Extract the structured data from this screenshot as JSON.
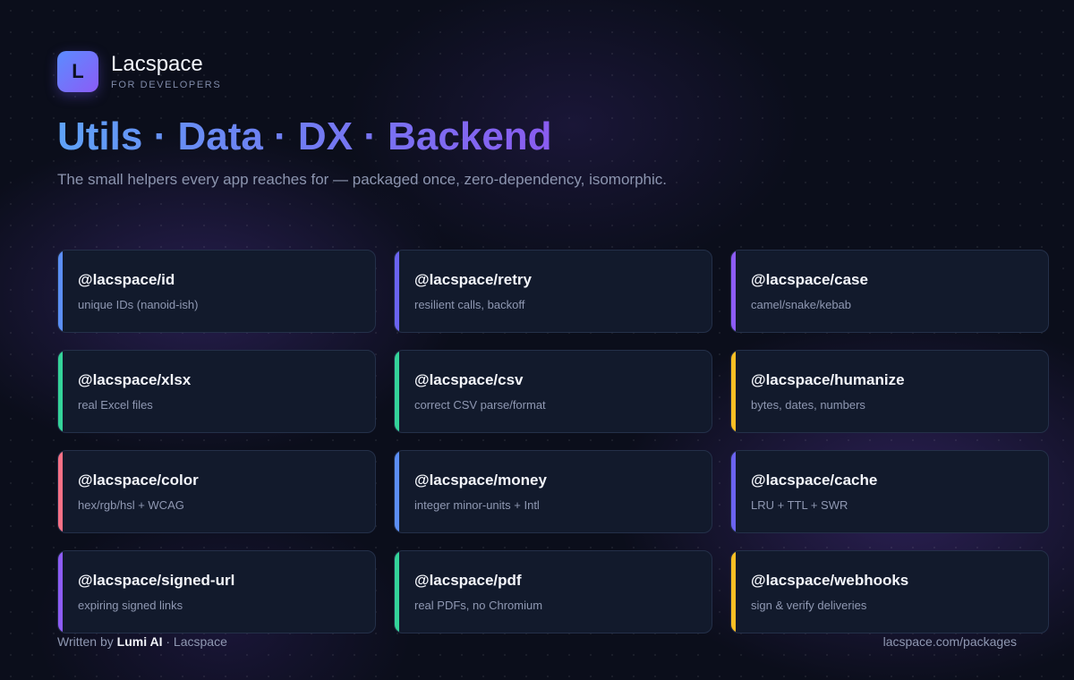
{
  "brand": {
    "logo_letter": "L",
    "name": "Lacspace",
    "tagline": "FOR DEVELOPERS"
  },
  "headline": "Utils · Data · DX · Backend",
  "subtitle": "The small helpers every app reaches for — packaged once, zero-dependency, isomorphic.",
  "accent_colors": {
    "blue": "#5b8ef5",
    "indigo": "#6b63f0",
    "purple": "#8d5cf6",
    "green": "#34d399",
    "yellow": "#fbbf24",
    "red": "#f87186"
  },
  "packages": [
    {
      "name": "@lacspace/id",
      "desc": "unique IDs (nanoid-ish)",
      "accent": "#5b8ef5"
    },
    {
      "name": "@lacspace/retry",
      "desc": "resilient calls, backoff",
      "accent": "#6b63f0"
    },
    {
      "name": "@lacspace/case",
      "desc": "camel/snake/kebab",
      "accent": "#8d5cf6"
    },
    {
      "name": "@lacspace/xlsx",
      "desc": "real Excel files",
      "accent": "#34d399"
    },
    {
      "name": "@lacspace/csv",
      "desc": "correct CSV parse/format",
      "accent": "#34d399"
    },
    {
      "name": "@lacspace/humanize",
      "desc": "bytes, dates, numbers",
      "accent": "#fbbf24"
    },
    {
      "name": "@lacspace/color",
      "desc": "hex/rgb/hsl + WCAG",
      "accent": "#f87186"
    },
    {
      "name": "@lacspace/money",
      "desc": "integer minor-units + Intl",
      "accent": "#5b8ef5"
    },
    {
      "name": "@lacspace/cache",
      "desc": "LRU + TTL + SWR",
      "accent": "#6b63f0"
    },
    {
      "name": "@lacspace/signed-url",
      "desc": "expiring signed links",
      "accent": "#8d5cf6"
    },
    {
      "name": "@lacspace/pdf",
      "desc": "real PDFs, no Chromium",
      "accent": "#34d399"
    },
    {
      "name": "@lacspace/webhooks",
      "desc": "sign & verify deliveries",
      "accent": "#fbbf24"
    }
  ],
  "footer": {
    "written_by": "Written by",
    "author": "Lumi AI",
    "separator": " · ",
    "org": "Lacspace",
    "url": "lacspace.com/packages"
  }
}
